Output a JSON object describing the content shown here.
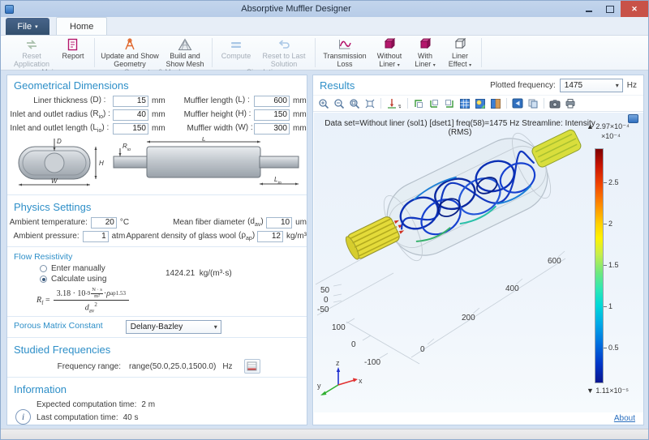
{
  "window": {
    "title": "Absorptive Muffler Designer"
  },
  "ribbon": {
    "file_label": "File",
    "dropdown_glyph": "▾",
    "home_tab": "Home",
    "groups": [
      {
        "label": "Main",
        "buttons": [
          {
            "label": "Reset Application",
            "icon": "reset-application-icon",
            "disabled": true
          },
          {
            "label": "Report",
            "icon": "report-icon",
            "disabled": false
          }
        ]
      },
      {
        "label": "Geometry & Mesh",
        "buttons": [
          {
            "label": "Update and Show Geometry",
            "icon": "update-geometry-icon",
            "disabled": false
          },
          {
            "label": "Build and Show Mesh",
            "icon": "build-mesh-icon",
            "disabled": false
          }
        ]
      },
      {
        "label": "Simulation",
        "buttons": [
          {
            "label": "Compute",
            "icon": "compute-icon",
            "disabled": true
          },
          {
            "label": "Reset to Last Solution",
            "icon": "reset-solution-icon",
            "disabled": true
          }
        ]
      },
      {
        "label": "Results",
        "buttons": [
          {
            "label": "Transmission Loss",
            "icon": "transmission-loss-icon",
            "disabled": false
          },
          {
            "label": "Without Liner",
            "icon": "without-liner-icon",
            "disabled": false,
            "dropdown": true
          },
          {
            "label": "With Liner",
            "icon": "with-liner-icon",
            "disabled": false,
            "dropdown": true
          },
          {
            "label": "Liner Effect",
            "icon": "liner-effect-icon",
            "disabled": false,
            "dropdown": true
          }
        ]
      }
    ]
  },
  "geometry": {
    "title": "Geometrical Dimensions",
    "col1": [
      {
        "label": "Liner thickness",
        "sym_pre": "(D",
        "sym_sub": "",
        "sym_post": ") :",
        "value": "15",
        "unit": "mm"
      },
      {
        "label": "Inlet and outlet radius",
        "sym_pre": "(R",
        "sym_sub": "io",
        "sym_post": ") :",
        "value": "40",
        "unit": "mm"
      },
      {
        "label": "Inlet and outlet length",
        "sym_pre": "(L",
        "sym_sub": "io",
        "sym_post": ") :",
        "value": "150",
        "unit": "mm"
      }
    ],
    "col2": [
      {
        "label": "Muffler length",
        "sym_pre": "(L",
        "sym_sub": "",
        "sym_post": ") :",
        "value": "600",
        "unit": "mm"
      },
      {
        "label": "Muffler height",
        "sym_pre": "(H",
        "sym_sub": "",
        "sym_post": ") :",
        "value": "150",
        "unit": "mm"
      },
      {
        "label": "Muffler width",
        "sym_pre": "(W",
        "sym_sub": "",
        "sym_post": ") :",
        "value": "300",
        "unit": "mm"
      }
    ],
    "diagram": {
      "d": "D",
      "h": "H",
      "w": "W",
      "l": "L",
      "r_pre": "R",
      "r_sub": "io",
      "l2_pre": "L",
      "l2_sub": "io"
    }
  },
  "physics": {
    "title": "Physics Settings",
    "rows": [
      {
        "l1": "Ambient temperature:",
        "v1": "20",
        "u1": "°C",
        "l2": "Mean fiber diameter",
        "s2_pre": "(d",
        "s2_sub": "av",
        "s2_post": ") :",
        "v2": "10",
        "u2": "um"
      },
      {
        "l1": "Ambient pressure:",
        "v1": "1",
        "u1": "atm",
        "l2": "Apparent density of glass wool",
        "s2_pre": "(ρ",
        "s2_sub": "ap",
        "s2_post": ") :",
        "v2": "12",
        "u2": "kg/m³"
      }
    ]
  },
  "flow": {
    "title": "Flow Resistivity",
    "radio1": "Enter manually",
    "radio2": "Calculate using",
    "value": "1424.21",
    "unit": "kg/(m³·s)",
    "formula": {
      "var": "R",
      "var_sub": "f",
      "eq": " = ",
      "coef": "3.18 · 10",
      "coef_exp": "-9",
      "unit_num": "N · s",
      "unit_den": "m²",
      "dot": " · ",
      "rho": "ρ",
      "rho_sub": "ap",
      "rho_exp": "1.53",
      "den": "d",
      "den_sub": "av",
      "den_exp": "2"
    }
  },
  "porous": {
    "label": "Porous Matrix Constant",
    "value": "Delany-Bazley"
  },
  "frequencies": {
    "title": "Studied Frequencies",
    "label": "Frequency range:",
    "value": "range(50.0,25.0,1500.0)",
    "unit": "Hz"
  },
  "information": {
    "title": "Information",
    "expected_label": "Expected computation time:",
    "expected_value": "2 m",
    "last_label": "Last computation time:",
    "last_value": "40 s"
  },
  "results": {
    "title": "Results",
    "freq_label": "Plotted frequency:",
    "freq_value": "1475",
    "freq_unit": "Hz",
    "toolbar_icons": [
      "zoom-in",
      "zoom-out",
      "zoom-box",
      "zoom-extents",
      "go-to-default-view",
      "view-xy",
      "view-yz",
      "view-zx",
      "show-grid",
      "scene-light",
      "transparency",
      "image-snapshot",
      "copy-image",
      "camera",
      "print"
    ],
    "plot_title": "Data set=Without liner (sol1) [dset1] freq(58)=1475 Hz   Streamline: Intensity (RMS)",
    "colorbar": {
      "max": "▲ 2.97×10⁻⁴",
      "scale": "×10⁻⁴",
      "ticks": [
        "2.5",
        "2",
        "1.5",
        "1",
        "0.5"
      ],
      "min": "▼ 1.11×10⁻⁵"
    },
    "axes": {
      "x": [
        "0",
        "200",
        "400",
        "600"
      ],
      "y": [
        "100",
        "0",
        "-100"
      ],
      "z": [
        "50",
        "0",
        "-50"
      ],
      "triad_x": "x",
      "triad_y": "y",
      "triad_z": "z"
    },
    "about": "About"
  }
}
